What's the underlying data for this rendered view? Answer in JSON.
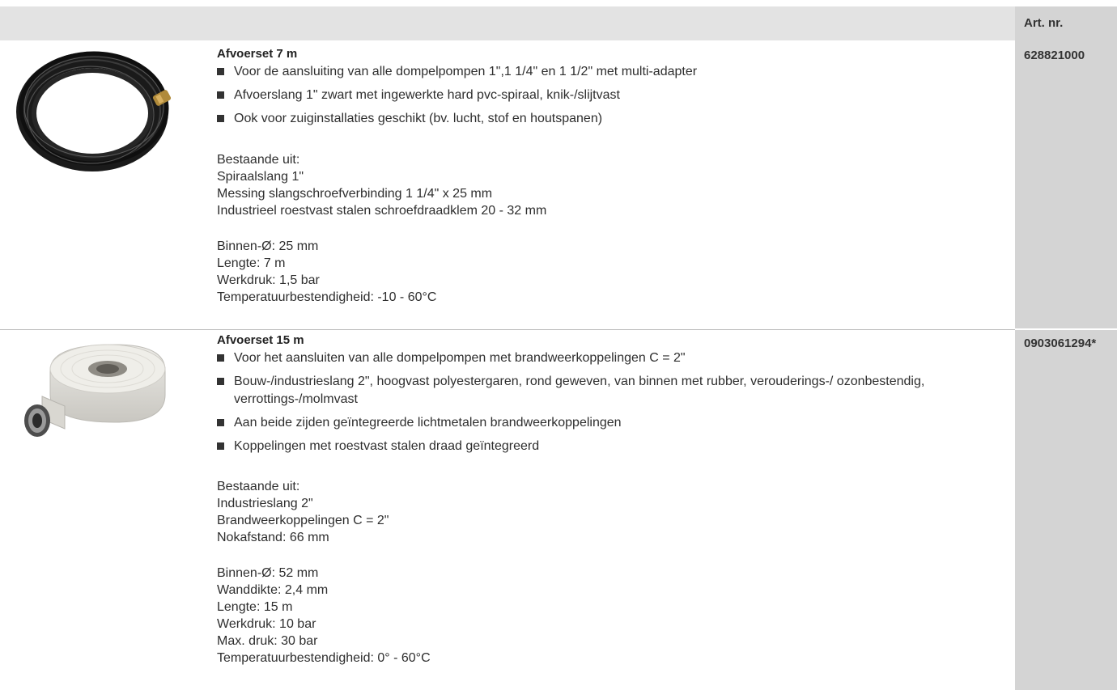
{
  "header": {
    "artnr_label": "Art. nr."
  },
  "products": [
    {
      "title": "Afvoerset 7 m",
      "bullets": [
        "Voor de aansluiting van alle dompelpompen 1\",1 1/4\" en 1 1/2\" met multi-adapter",
        "Afvoerslang 1\" zwart met ingewerkte hard pvc-spiraal, knik-/slijtvast",
        "Ook voor zuiginstallaties geschikt (bv. lucht, stof en houtspanen)"
      ],
      "consists_label": "Bestaande uit:",
      "consists": [
        "Spiraalslang 1\"",
        "Messing slangschroefverbinding 1 1/4\" x 25 mm",
        "Industrieel roestvast stalen schroefdraadklem 20 - 32 mm"
      ],
      "specs": [
        "Binnen-Ø: 25 mm",
        "Lengte: 7 m",
        "Werkdruk: 1,5 bar",
        "Temperatuurbestendigheid: -10 - 60°C"
      ],
      "artnr": "628821000",
      "image": "black-spiral-hose-coil"
    },
    {
      "title": "Afvoerset 15 m",
      "bullets": [
        "Voor het aansluiten van alle dompelpompen met brandweerkoppelingen C = 2\"",
        "Bouw-/industrieslang 2\", hoogvast polyestergaren, rond geweven, van binnen met rubber, verouderings-/ ozonbestendig, verrottings-/molmvast",
        "Aan beide zijden geïntegreerde lichtmetalen brandweerkoppelingen",
        "Koppelingen met roestvast stalen draad geïntegreerd"
      ],
      "consists_label": "Bestaande uit:",
      "consists": [
        "Industrieslang 2\"",
        "Brandweerkoppelingen C = 2\"",
        "Nokafstand: 66 mm"
      ],
      "specs": [
        "Binnen-Ø: 52 mm",
        "Wanddikte: 2,4 mm",
        "Lengte: 15 m",
        "Werkdruk: 10 bar",
        "Max. druk: 30 bar",
        "Temperatuurbestendigheid: 0° - 60°C"
      ],
      "artnr": "0903061294*",
      "image": "white-flat-fire-hose-roll"
    }
  ]
}
